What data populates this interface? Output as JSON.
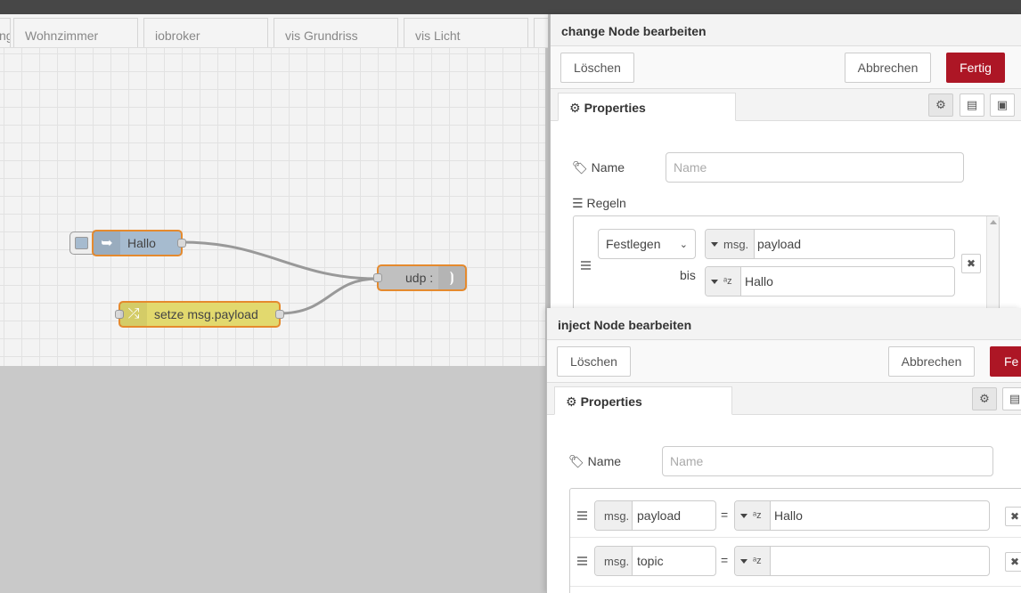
{
  "tabs": [
    {
      "label": "ng"
    },
    {
      "label": "Wohnzimmer"
    },
    {
      "label": "iobroker"
    },
    {
      "label": "vis Grundriss"
    },
    {
      "label": "vis Licht"
    },
    {
      "label": ""
    }
  ],
  "flow": {
    "inject_node": {
      "label": "Hallo"
    },
    "change_node": {
      "label": "setze msg.payload"
    },
    "udp_node": {
      "label": "udp :"
    }
  },
  "change_tray": {
    "title": "change Node bearbeiten",
    "delete_label": "Löschen",
    "cancel_label": "Abbrechen",
    "done_label": "Fertig",
    "properties_tab": "Properties",
    "name_label": "Name",
    "name_placeholder": "Name",
    "rules_label": "Regeln",
    "rule": {
      "action": "Festlegen",
      "target_prefix": "msg.",
      "target_value": "payload",
      "to_label": "bis",
      "to_value": "Hallo"
    },
    "action_options": [
      "Festlegen"
    ]
  },
  "inject_tray": {
    "title": "inject Node bearbeiten",
    "delete_label": "Löschen",
    "cancel_label": "Abbrechen",
    "done_label": "Fe",
    "properties_tab": "Properties",
    "name_label": "Name",
    "name_placeholder": "Name",
    "props": [
      {
        "prefix": "msg.",
        "key": "payload",
        "equals": "=",
        "value": "Hallo"
      },
      {
        "prefix": "msg.",
        "key": "topic",
        "equals": "=",
        "value": ""
      }
    ]
  },
  "colors": {
    "accent": "#ad1625",
    "node_border": "#e58a2e",
    "inject_node": "#a6bbcf",
    "change_node": "#e2d96e",
    "udp_node": "#c0c0c0"
  },
  "icons": [
    "gear-icon",
    "tag-icon",
    "list-icon",
    "info-icon",
    "description-icon",
    "appearance-icon",
    "drag-handle-icon",
    "close-icon",
    "inject-arrow-icon",
    "shuffle-icon",
    "wifi-icon"
  ]
}
